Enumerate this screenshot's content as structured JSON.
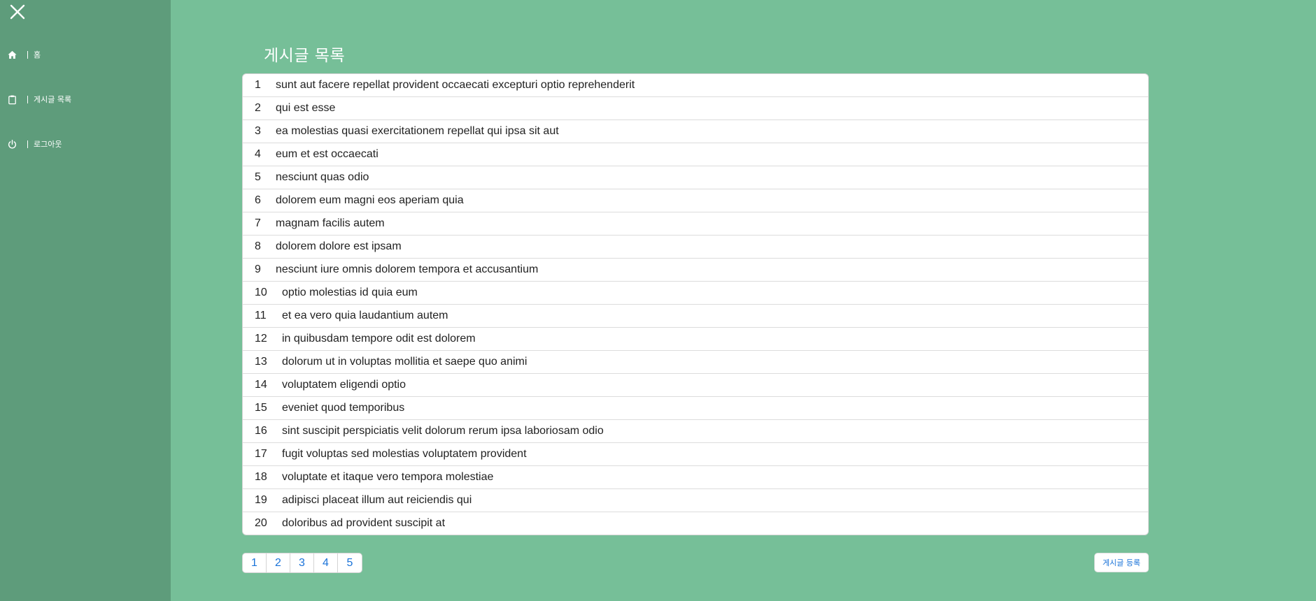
{
  "sidebar": {
    "items": [
      {
        "icon": "home-icon",
        "label": "홈"
      },
      {
        "icon": "clipboard-icon",
        "label": "게시글 목록"
      },
      {
        "icon": "power-icon",
        "label": "로그아웃"
      }
    ]
  },
  "main": {
    "title": "게시글 목록",
    "posts": [
      {
        "id": "1",
        "title": "sunt aut facere repellat provident occaecati excepturi optio reprehenderit"
      },
      {
        "id": "2",
        "title": "qui est esse"
      },
      {
        "id": "3",
        "title": "ea molestias quasi exercitationem repellat qui ipsa sit aut"
      },
      {
        "id": "4",
        "title": "eum et est occaecati"
      },
      {
        "id": "5",
        "title": "nesciunt quas odio"
      },
      {
        "id": "6",
        "title": "dolorem eum magni eos aperiam quia"
      },
      {
        "id": "7",
        "title": "magnam facilis autem"
      },
      {
        "id": "8",
        "title": "dolorem dolore est ipsam"
      },
      {
        "id": "9",
        "title": "nesciunt iure omnis dolorem tempora et accusantium"
      },
      {
        "id": "10",
        "title": "optio molestias id quia eum"
      },
      {
        "id": "11",
        "title": "et ea vero quia laudantium autem"
      },
      {
        "id": "12",
        "title": "in quibusdam tempore odit est dolorem"
      },
      {
        "id": "13",
        "title": "dolorum ut in voluptas mollitia et saepe quo animi"
      },
      {
        "id": "14",
        "title": "voluptatem eligendi optio"
      },
      {
        "id": "15",
        "title": "eveniet quod temporibus"
      },
      {
        "id": "16",
        "title": "sint suscipit perspiciatis velit dolorum rerum ipsa laboriosam odio"
      },
      {
        "id": "17",
        "title": "fugit voluptas sed molestias voluptatem provident"
      },
      {
        "id": "18",
        "title": "voluptate et itaque vero tempora molestiae"
      },
      {
        "id": "19",
        "title": "adipisci placeat illum aut reiciendis qui"
      },
      {
        "id": "20",
        "title": "doloribus ad provident suscipit at"
      }
    ],
    "pagination": [
      "1",
      "2",
      "3",
      "4",
      "5"
    ],
    "write_button_label": "게시글 등록"
  },
  "colors": {
    "background": "#76bf98",
    "sidebar": "#5e9c7b",
    "link": "#1a73d9"
  }
}
